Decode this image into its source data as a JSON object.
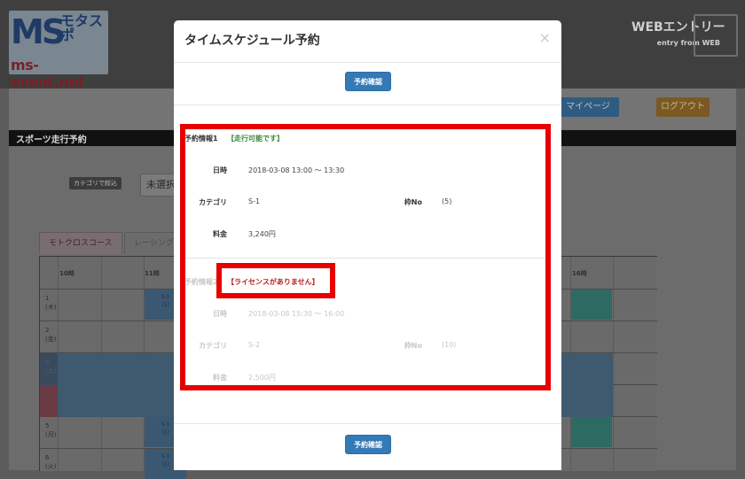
{
  "header": {
    "logo_main": "MS",
    "logo_kana": "モタスポ",
    "logo_net": ".net",
    "logo_url": "ms-event.net",
    "web_entry_title": "WEBエントリー",
    "web_entry_sub": "entry from WEB"
  },
  "nav": {
    "mypage_label": "マイページ",
    "logout_label": "ログアウト"
  },
  "section": {
    "title": "スポーツ走行予約"
  },
  "filter": {
    "category_label": "カテゴリで絞込",
    "category_value": "未選択"
  },
  "tabs": [
    {
      "label": "モトクロスコース",
      "active": true
    },
    {
      "label": "レーシング",
      "active": false
    }
  ],
  "schedule": {
    "hours": [
      "10時",
      "11時",
      "16時"
    ],
    "days": [
      {
        "num": "1",
        "dow": "(木)"
      },
      {
        "num": "2",
        "dow": "(金)"
      },
      {
        "num": "3",
        "dow": "(土)"
      },
      {
        "num": "4",
        "dow": "(日)"
      },
      {
        "num": "5",
        "dow": "(月)"
      },
      {
        "num": "6",
        "dow": "(火)"
      }
    ],
    "slots": [
      {
        "cat": "S-1",
        "no": "(1)"
      },
      {
        "cat": "S-1",
        "no": "(1)"
      },
      {
        "cat": "S-1",
        "no": "(1)"
      }
    ]
  },
  "modal": {
    "title": "タイムスケジュール予約",
    "close_label": "×",
    "confirm_label": "予約確認",
    "reservations": [
      {
        "heading": "予約情報1",
        "status": "【走行可能です】",
        "datetime_label": "日時",
        "datetime_value": "2018-03-08 13:00 〜 13:30",
        "category_label": "カテゴリ",
        "category_value": "S-1",
        "frame_label": "枠No",
        "frame_value": "(5)",
        "fee_label": "料金",
        "fee_value": "3,240円"
      },
      {
        "heading": "予約情報2",
        "status": "【ライセンスがありません】",
        "datetime_label": "日時",
        "datetime_value": "2018-03-08 15:30 〜 16:00",
        "category_label": "カテゴリ",
        "category_value": "S-2",
        "frame_label": "枠No",
        "frame_value": "(10)",
        "fee_label": "料金",
        "fee_value": "2,500円"
      }
    ]
  },
  "colors": {
    "primary": "#337ab7",
    "highlight": "#e60000",
    "status_ok": "#3c8a3c",
    "status_ng": "#b81c1c"
  }
}
